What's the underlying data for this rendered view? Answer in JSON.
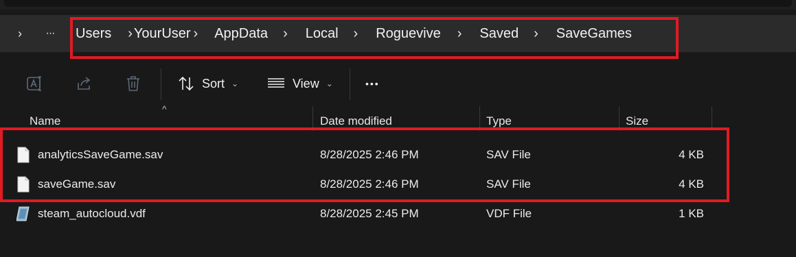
{
  "address_bar": {
    "overflow_glyph": "›",
    "more_glyph": "···",
    "separator": "›",
    "crumbs": [
      "Users",
      "YourUser",
      "AppData",
      "Local",
      "Roguevive",
      "Saved",
      "SaveGames"
    ]
  },
  "toolbar": {
    "sort_label": "Sort",
    "view_label": "View",
    "more_glyph": "•••",
    "chevron_glyph": "⌄",
    "icons": [
      "rename-icon",
      "share-icon",
      "delete-icon",
      "sort-icon",
      "view-icon",
      "more-icon"
    ]
  },
  "columns": {
    "name": "Name",
    "date": "Date modified",
    "type": "Type",
    "size": "Size",
    "sort_indicator": "^"
  },
  "files": [
    {
      "name": "analyticsSaveGame.sav",
      "date": "8/28/2025 2:46 PM",
      "type": "SAV File",
      "size": "4 KB",
      "icon": "file-icon"
    },
    {
      "name": "saveGame.sav",
      "date": "8/28/2025 2:46 PM",
      "type": "SAV File",
      "size": "4 KB",
      "icon": "file-icon"
    },
    {
      "name": "steam_autocloud.vdf",
      "date": "8/28/2025 2:45 PM",
      "type": "VDF File",
      "size": "1 KB",
      "icon": "vdf-file-icon"
    }
  ],
  "colors": {
    "background": "#191919",
    "address_bar": "#2b2b2b",
    "highlight": "#e01b24"
  }
}
